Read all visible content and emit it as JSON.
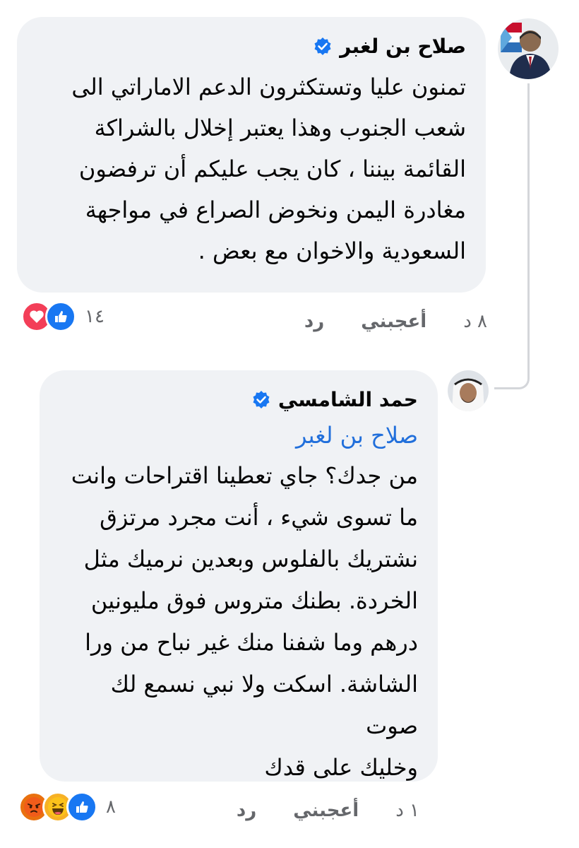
{
  "comments": [
    {
      "author": "صلاح بن لغبر",
      "verified_icon": "verified-badge-icon",
      "text_lines": [
        "تمنون عليا وتستكثرون الدعم الاماراتي الى",
        "شعب الجنوب وهذا يعتبر إخلال بالشراكة",
        "القائمة بيننا ، كان يجب عليكم أن ترفضون",
        "مغادرة اليمن ونخوض الصراع في مواجهة",
        "السعودية والاخوان مع بعض ."
      ],
      "time": "٨ د",
      "like_label": "أعجبني",
      "reply_label": "رد",
      "reaction_count": "١٤",
      "reactions": [
        "like-icon",
        "love-icon"
      ]
    },
    {
      "author": "حمد الشامسي",
      "verified_icon": "verified-badge-icon",
      "mention": "صلاح بن لغبر",
      "text_lines": [
        "من جدك؟ جاي تعطينا اقتراحات وانت",
        "ما تسوى شيء ، أنت مجرد مرتزق",
        "نشتريك بالفلوس وبعدين نرميك مثل",
        "الخردة. بطنك متروس فوق مليونين",
        "درهم وما شفنا منك غير نباح من ورا",
        "الشاشة. اسكت ولا نبي نسمع لك صوت",
        "وخليك على قدك"
      ],
      "time": "١ د",
      "like_label": "أعجبني",
      "reply_label": "رد",
      "reaction_count": "٨",
      "reactions": [
        "like-icon",
        "haha-icon",
        "angry-icon"
      ]
    }
  ],
  "colors": {
    "bubble_bg": "#f0f2f5",
    "mention_blue": "#216fdb",
    "verified_blue": "#1877f2",
    "meta_gray": "#65676b",
    "text": "#050505"
  }
}
